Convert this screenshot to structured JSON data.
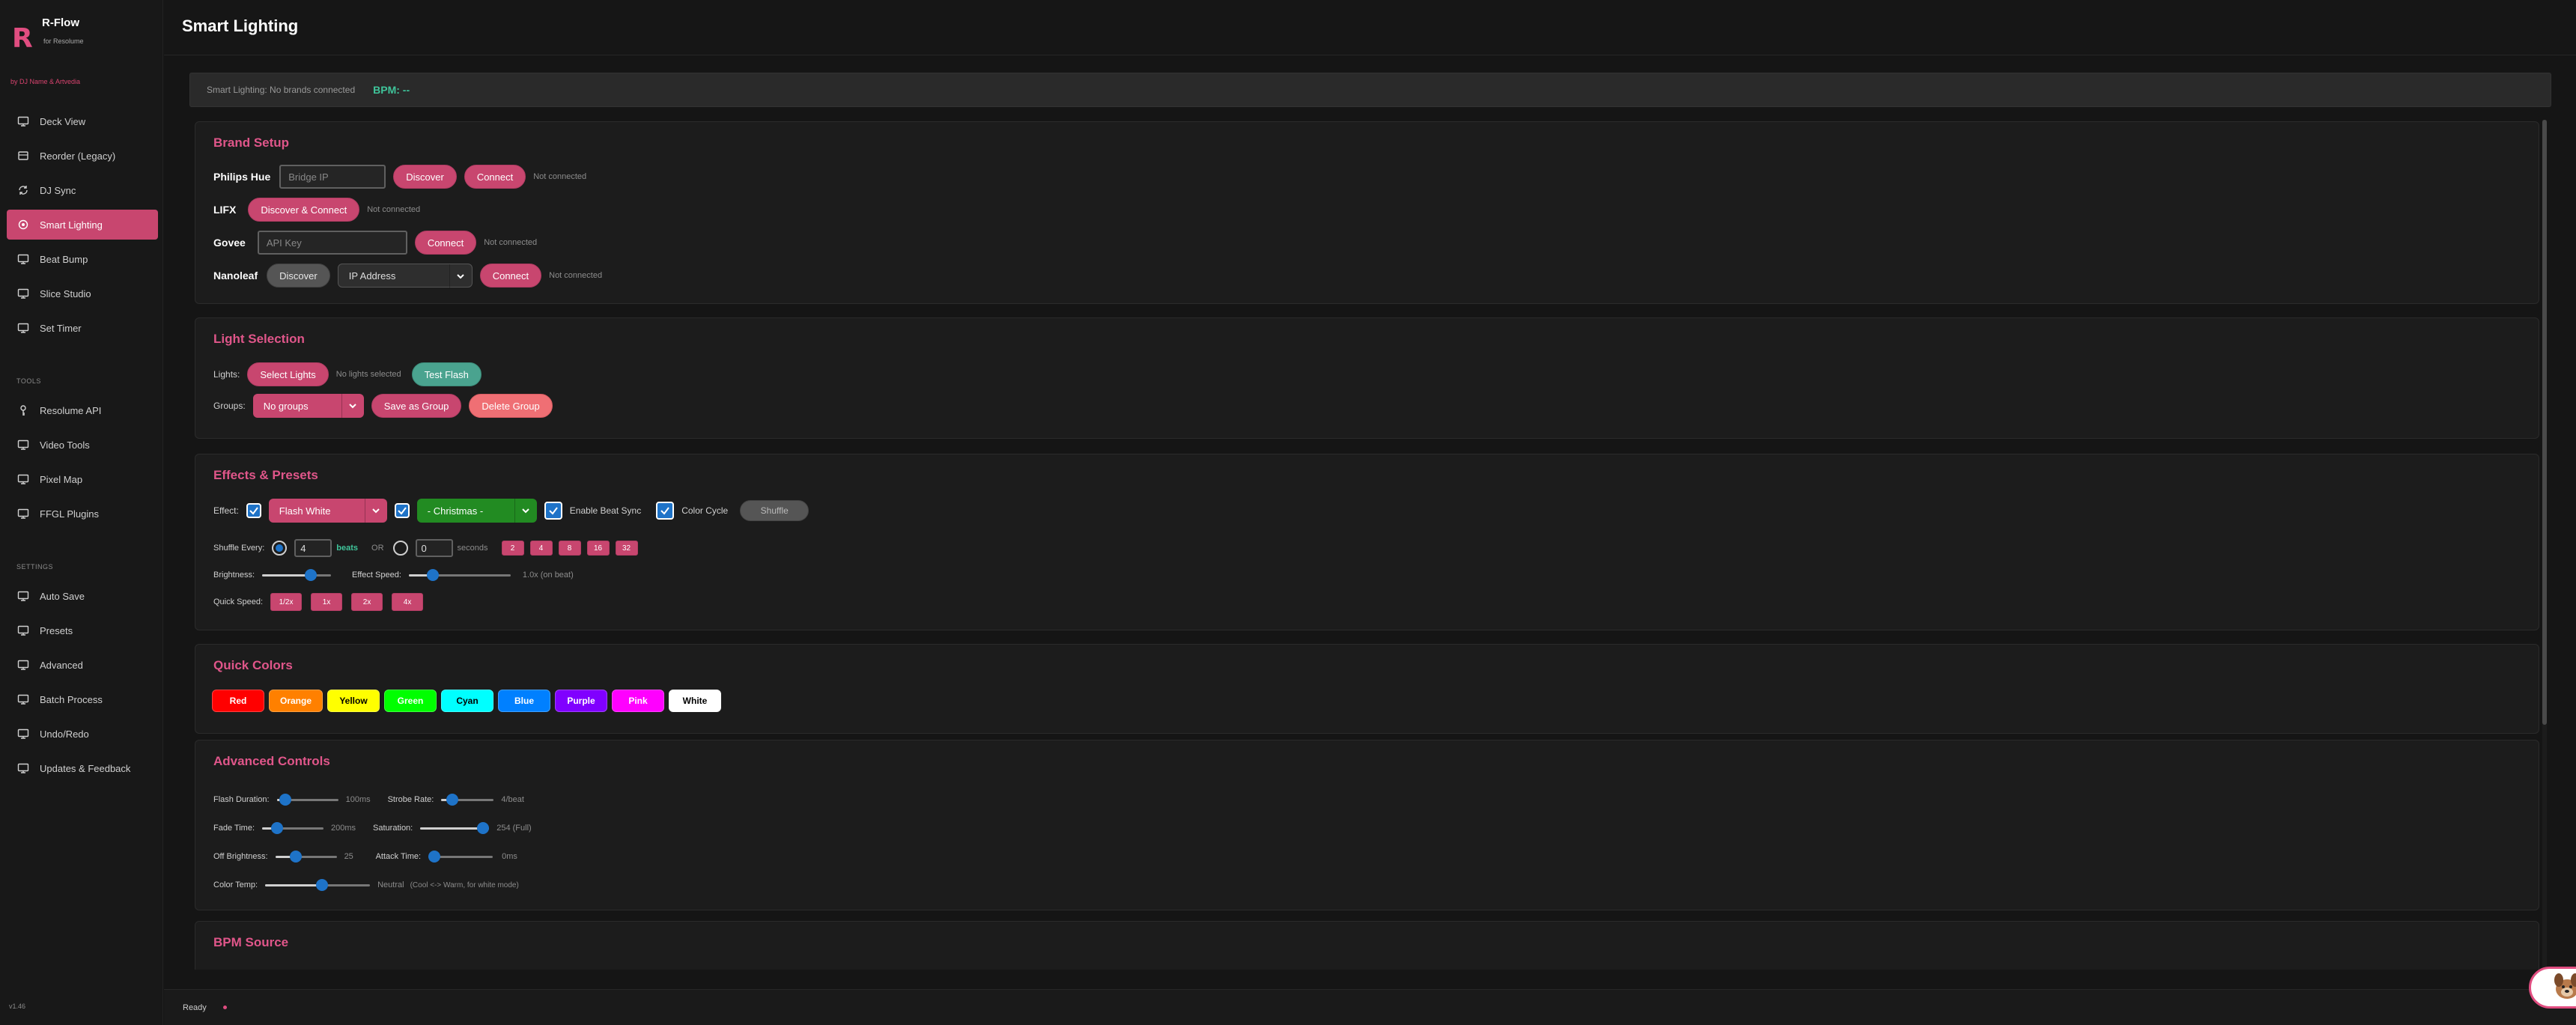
{
  "app": {
    "name": "R-Flow",
    "subtitle": "for Resolume",
    "byline": "by DJ Name & Artvedia",
    "version": "v1.46"
  },
  "sidebar": {
    "main_items": [
      {
        "label": "Deck View",
        "icon": "monitor-icon"
      },
      {
        "label": "Reorder (Legacy)",
        "icon": "layers-icon"
      },
      {
        "label": "DJ Sync",
        "icon": "sync-icon"
      },
      {
        "label": "Smart Lighting",
        "icon": "bulb-icon",
        "active": true
      },
      {
        "label": "Beat Bump",
        "icon": "monitor-icon"
      },
      {
        "label": "Slice Studio",
        "icon": "monitor-icon"
      },
      {
        "label": "Set Timer",
        "icon": "monitor-icon"
      }
    ],
    "tools_header": "TOOLS",
    "tools_items": [
      {
        "label": "Resolume API",
        "icon": "key-icon"
      },
      {
        "label": "Video Tools",
        "icon": "monitor-icon"
      },
      {
        "label": "Pixel Map",
        "icon": "monitor-icon"
      },
      {
        "label": "FFGL Plugins",
        "icon": "monitor-icon"
      }
    ],
    "settings_header": "SETTINGS",
    "settings_items": [
      {
        "label": "Auto Save",
        "icon": "monitor-icon"
      },
      {
        "label": "Presets",
        "icon": "monitor-icon"
      },
      {
        "label": "Advanced",
        "icon": "monitor-icon"
      },
      {
        "label": "Batch Process",
        "icon": "monitor-icon"
      },
      {
        "label": "Undo/Redo",
        "icon": "monitor-icon"
      },
      {
        "label": "Updates & Feedback",
        "icon": "monitor-icon"
      }
    ]
  },
  "header": {
    "title": "Smart Lighting"
  },
  "status": {
    "text": "Smart Lighting: No brands connected",
    "bpm": "BPM: --"
  },
  "brand_setup": {
    "title": "Brand Setup",
    "philips": {
      "label": "Philips Hue",
      "ip_placeholder": "Bridge IP",
      "discover": "Discover",
      "connect": "Connect",
      "status": "Not connected"
    },
    "lifx": {
      "label": "LIFX",
      "discover_connect": "Discover & Connect",
      "status": "Not connected"
    },
    "govee": {
      "label": "Govee",
      "key_placeholder": "API Key",
      "connect": "Connect",
      "status": "Not connected"
    },
    "nanoleaf": {
      "label": "Nanoleaf",
      "discover": "Discover",
      "ip_select": "IP Address",
      "connect": "Connect",
      "status": "Not connected"
    }
  },
  "light_selection": {
    "title": "Light Selection",
    "lights_label": "Lights:",
    "select_lights": "Select Lights",
    "no_lights": "No lights selected",
    "test_flash": "Test Flash",
    "groups_label": "Groups:",
    "groups_value": "No groups",
    "save_group": "Save as Group",
    "delete_group": "Delete Group"
  },
  "effects": {
    "title": "Effects & Presets",
    "effect_label": "Effect:",
    "effect_value": "Flash White",
    "preset_value": "- Christmas -",
    "beat_sync": "Enable Beat Sync",
    "color_cycle": "Color Cycle",
    "shuffle": "Shuffle",
    "shuffle_every": "Shuffle Every:",
    "beats_value": "4",
    "beats_unit": "beats",
    "or": "OR",
    "seconds_value": "0",
    "seconds_unit": "seconds",
    "beat_presets": [
      "2",
      "4",
      "8",
      "16",
      "32"
    ],
    "brightness_label": "Brightness:",
    "brightness_value": 0.75,
    "effect_speed_label": "Effect Speed:",
    "effect_speed_value": 0.2,
    "effect_speed_text": "1.0x (on beat)",
    "quick_speed_label": "Quick Speed:",
    "quick_speeds": [
      "1/2x",
      "1x",
      "2x",
      "4x"
    ]
  },
  "quick_colors": {
    "title": "Quick Colors",
    "colors": [
      {
        "label": "Red",
        "bg": "#ff0000",
        "fg": "#ffffff"
      },
      {
        "label": "Orange",
        "bg": "#ff8000",
        "fg": "#ffffff"
      },
      {
        "label": "Yellow",
        "bg": "#ffff00",
        "fg": "#000000"
      },
      {
        "label": "Green",
        "bg": "#00ff00",
        "fg": "#ffffff"
      },
      {
        "label": "Cyan",
        "bg": "#00ffff",
        "fg": "#000000"
      },
      {
        "label": "Blue",
        "bg": "#0080ff",
        "fg": "#ffffff"
      },
      {
        "label": "Purple",
        "bg": "#8000ff",
        "fg": "#ffffff"
      },
      {
        "label": "Pink",
        "bg": "#ff00ff",
        "fg": "#ffffff"
      },
      {
        "label": "White",
        "bg": "#ffffff",
        "fg": "#000000"
      }
    ]
  },
  "advanced": {
    "title": "Advanced Controls",
    "flash_duration": {
      "label": "Flash Duration:",
      "value": 0.05,
      "text": "100ms"
    },
    "strobe_rate": {
      "label": "Strobe Rate:",
      "value": 0.12,
      "text": "4/beat"
    },
    "fade_time": {
      "label": "Fade Time:",
      "value": 0.18,
      "text": "200ms"
    },
    "saturation": {
      "label": "Saturation:",
      "value": 1.0,
      "text": "254 (Full)"
    },
    "off_brightness": {
      "label": "Off Brightness:",
      "value": 0.3,
      "text": "25"
    },
    "attack_time": {
      "label": "Attack Time:",
      "value": 0.0,
      "text": "0ms"
    },
    "color_temp": {
      "label": "Color Temp:",
      "value": 0.55,
      "text": "Neutral",
      "hint": "(Cool <-> Warm, for white mode)"
    }
  },
  "bpm_source": {
    "title": "BPM Source"
  },
  "footer": {
    "status": "Ready"
  },
  "theme": {
    "accent": "#c8466f",
    "accent_text": "#e0568a",
    "bpm_color": "#3fc49a"
  }
}
